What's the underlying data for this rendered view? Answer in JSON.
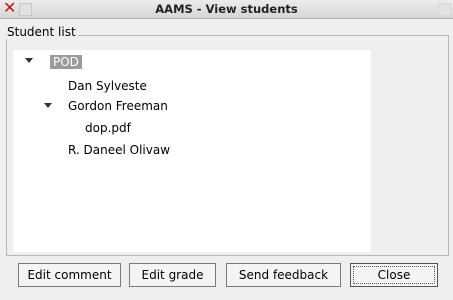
{
  "window": {
    "title": "AAMS - View students"
  },
  "group": {
    "label": "Student list"
  },
  "tree": {
    "root": "POD",
    "child1": "Dan Sylveste",
    "child2": "Gordon Freeman",
    "grandchild": "dop.pdf",
    "child3": "R. Daneel Olivaw"
  },
  "buttons": {
    "edit_comment": "Edit comment",
    "edit_grade": "Edit grade",
    "send_feedback": "Send feedback",
    "close": "Close"
  }
}
